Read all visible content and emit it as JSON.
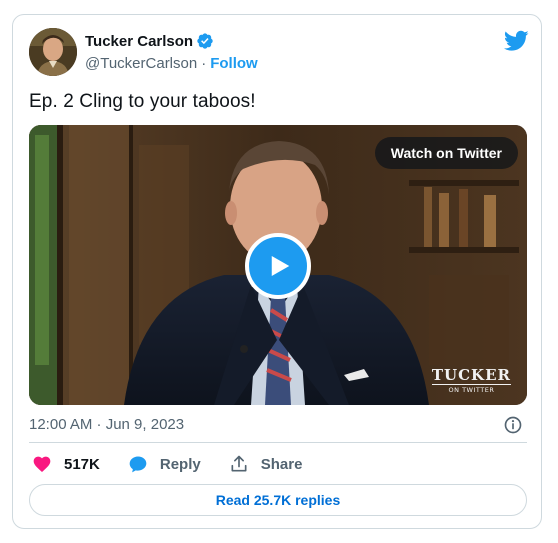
{
  "author": {
    "name": "Tucker Carlson",
    "handle": "@TuckerCarlson",
    "separator": "·",
    "follow_label": "Follow"
  },
  "tweet": {
    "text": "Ep. 2  Cling to your taboos!",
    "timestamp": "12:00 AM · Jun 9, 2023"
  },
  "media": {
    "watch_label": "Watch on Twitter",
    "watermark_main": "TUCKER",
    "watermark_sub": "ON TWITTER"
  },
  "actions": {
    "likes": "517K",
    "reply_label": "Reply",
    "share_label": "Share",
    "read_replies_label": "Read 25.7K replies"
  },
  "colors": {
    "accent": "#1d9bf0",
    "like": "#f91880",
    "muted_text": "#536471",
    "border": "#cfd9de"
  },
  "icons": [
    "verified-badge-icon",
    "twitter-bird-icon",
    "play-icon",
    "info-icon",
    "heart-icon",
    "reply-bubble-icon",
    "share-icon"
  ]
}
